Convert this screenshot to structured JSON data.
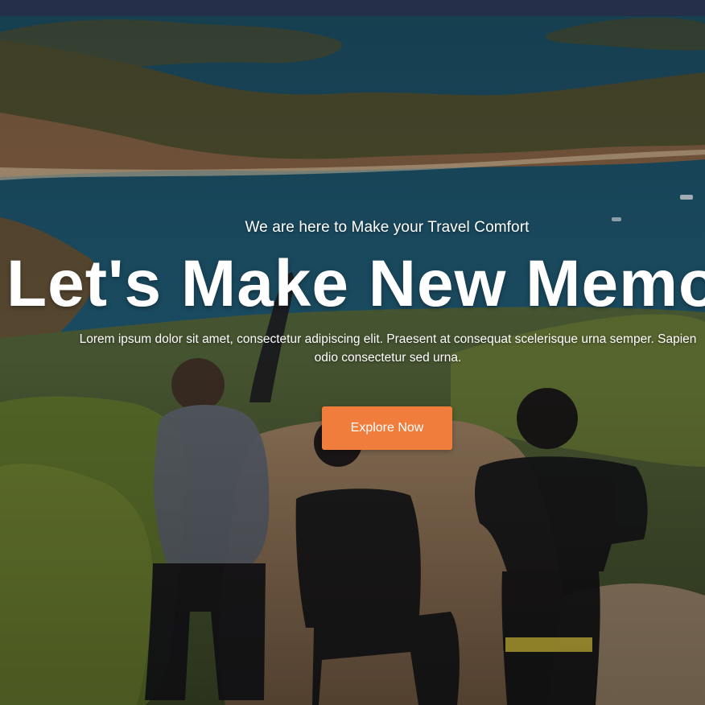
{
  "hero": {
    "kicker": "We are here to Make your Travel Comfort",
    "headline": "Let's Make New Memori",
    "description": "Lorem ipsum dolor sit amet, consectetur adipiscing elit. Praesent at consequat scelerisque urna semper. Sapien odio consectetur sed urna.",
    "cta_label": "Explore Now"
  },
  "colors": {
    "accent": "#f07d3c",
    "top_bar": "#252f4a",
    "text": "#ffffff"
  }
}
